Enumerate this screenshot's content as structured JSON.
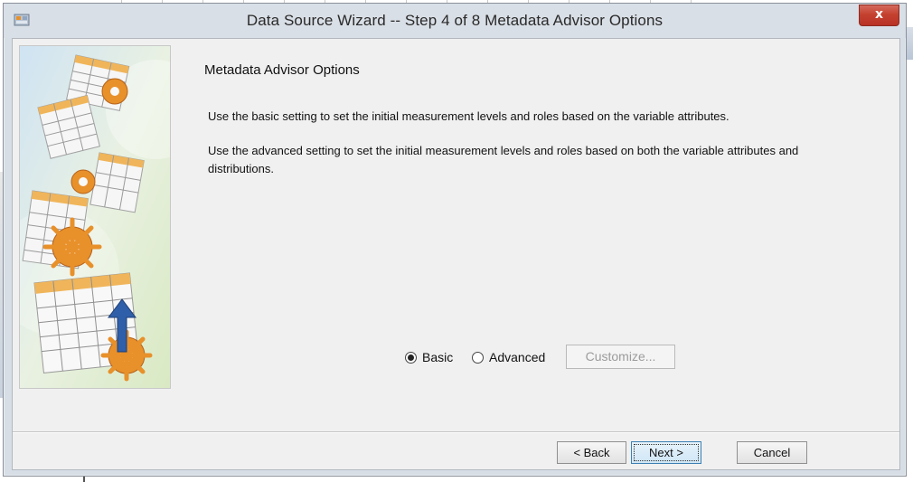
{
  "background": {
    "description_hidden": ""
  },
  "window": {
    "title": "Data Source Wizard  -- Step 4 of 8  Metadata Advisor Options",
    "close_label": "x",
    "app_icon": "sas-app-icon"
  },
  "content": {
    "heading": "Metadata Advisor Options",
    "paragraph1": "Use the basic setting to set the initial measurement levels and roles based on the variable attributes.",
    "paragraph2": "Use the advanced setting to set the initial measurement levels and roles based on both the variable attributes and distributions."
  },
  "options": {
    "basic_label": "Basic",
    "advanced_label": "Advanced",
    "selected": "Basic",
    "customize_label": "Customize..."
  },
  "buttons": {
    "back_label": "< Back",
    "next_label": "Next >",
    "cancel_label": "Cancel"
  },
  "colors": {
    "close_button": "#c5412f",
    "dialog_frame": "#d7dee6",
    "client_bg": "#f0f0f0",
    "accent_orange": "#e8902a",
    "arrow_blue": "#2f5fa8"
  }
}
